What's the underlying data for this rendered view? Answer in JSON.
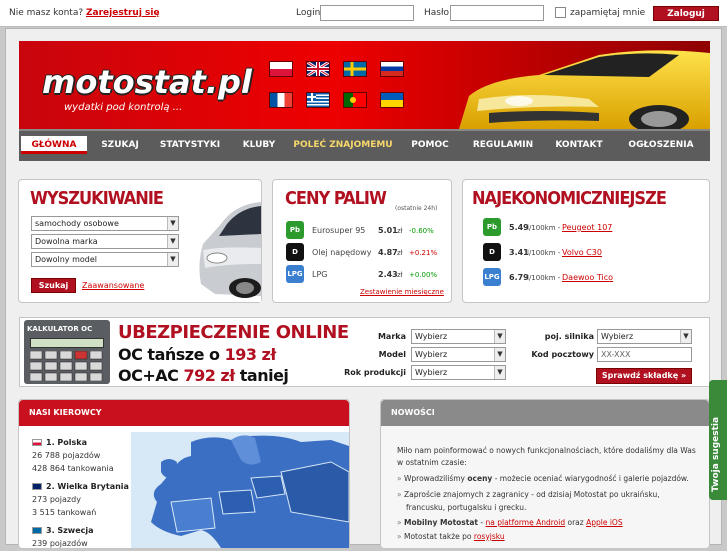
{
  "topbar": {
    "no_account": "Nie masz konta?",
    "register": "Zarejestruj się",
    "login_label": "Login:",
    "password_label": "Hasło:",
    "remember": "zapamiętaj mnie",
    "login_button": "Zaloguj"
  },
  "banner": {
    "logo": "motostat.pl",
    "tagline": "wydatki pod kontrolą ...",
    "flags": [
      "pl",
      "gb",
      "se",
      "ru",
      "fr",
      "gr",
      "pt",
      "ua"
    ]
  },
  "nav": [
    "GŁÓWNA",
    "SZUKAJ",
    "STATYSTYKI",
    "KLUBY",
    "POLEĆ ZNAJOMEMU",
    "POMOC",
    "REGULAMIN",
    "KONTAKT",
    "OGŁOSZENIA"
  ],
  "search": {
    "title": "WYSZUKIWANIE",
    "selects": [
      "samochody osobowe",
      "Dowolna marka",
      "Dowolny model"
    ],
    "button": "Szukaj",
    "advanced": "Zaawansowane"
  },
  "fuel": {
    "title": "CENY PALIW",
    "subtitle": "(ostatnie 24h)",
    "rows": [
      {
        "icon": "Pb",
        "name": "Eurosuper 95",
        "price": "5.01",
        "unit": "zł",
        "change": "-0.60%",
        "color": "#2d9a2d"
      },
      {
        "icon": "D",
        "name": "Olej napędowy",
        "price": "4.87",
        "unit": "zł",
        "change": "+0.21%",
        "color": "#111111"
      },
      {
        "icon": "LPG",
        "name": "LPG",
        "price": "2.43",
        "unit": "zł",
        "change": "+0.00%",
        "color": "#3a7fd0"
      }
    ],
    "link": "Zestawienie miesięczne"
  },
  "economy": {
    "title": "NAJEKONOMICZNIEJSZE",
    "rows": [
      {
        "icon": "Pb",
        "value": "5.49",
        "unit": "l/100km -",
        "car": "Peugeot 107",
        "color": "#2d9a2d"
      },
      {
        "icon": "D",
        "value": "3.41",
        "unit": "l/100km -",
        "car": "Volvo C30",
        "color": "#111111"
      },
      {
        "icon": "LPG",
        "value": "6.79",
        "unit": "l/100km -",
        "car": "Daewoo Tico",
        "color": "#3a7fd0"
      }
    ]
  },
  "insurance": {
    "calc_label": "KALKULATOR OC",
    "headline": "UBEZPIECZENIE ONLINE",
    "line2_a": "OC tańsze o",
    "line2_b": "193 zł",
    "line3_a": "OC+AC",
    "line3_b": "792 zł",
    "line3_c": "taniej",
    "fields": {
      "marka_label": "Marka",
      "marka_value": "Wybierz",
      "model_label": "Model",
      "model_value": "Wybierz",
      "rok_label": "Rok produkcji",
      "rok_value": "Wybierz",
      "silnik_label": "poj. silnika",
      "silnik_value": "Wybierz",
      "kod_label": "Kod pocztowy",
      "kod_value": "XX-XXX"
    },
    "button": "Sprawdź składkę »"
  },
  "drivers": {
    "title": "NASI KIEROWCY",
    "countries": [
      {
        "rank": "1. Polska",
        "vehicles": "26 788 pojazdów",
        "refuels": "428 864 tankowania"
      },
      {
        "rank": "2. Wielka Brytania",
        "vehicles": "273 pojazdy",
        "refuels": "3 515 tankowań"
      },
      {
        "rank": "3. Szwecja",
        "vehicles": "239 pojazdów",
        "refuels": ""
      }
    ]
  },
  "news": {
    "title": "NOWOŚCI",
    "intro": "Miło nam poinformować o nowych funkcjonalnościach, które dodaliśmy dla Was w ostatnim czasie:",
    "item1_a": "Wprowadziliśmy",
    "item1_b": "oceny",
    "item1_c": "- możecie oceniać wiarygodność i galerie pojazdów.",
    "item2": "Zaproście znajomych z zagranicy - od dzisiaj Motostat po ukraińsku, francusku, portugalsku i grecku.",
    "item3_a": "Mobilny Motostat",
    "item3_b": "-",
    "item3_c": "na platformę Android",
    "item3_d": "oraz",
    "item3_e": "Apple iOS",
    "item4_a": "Motostat także po",
    "item4_b": "rosyjsku"
  },
  "suggestion": "Twoja sugestia"
}
